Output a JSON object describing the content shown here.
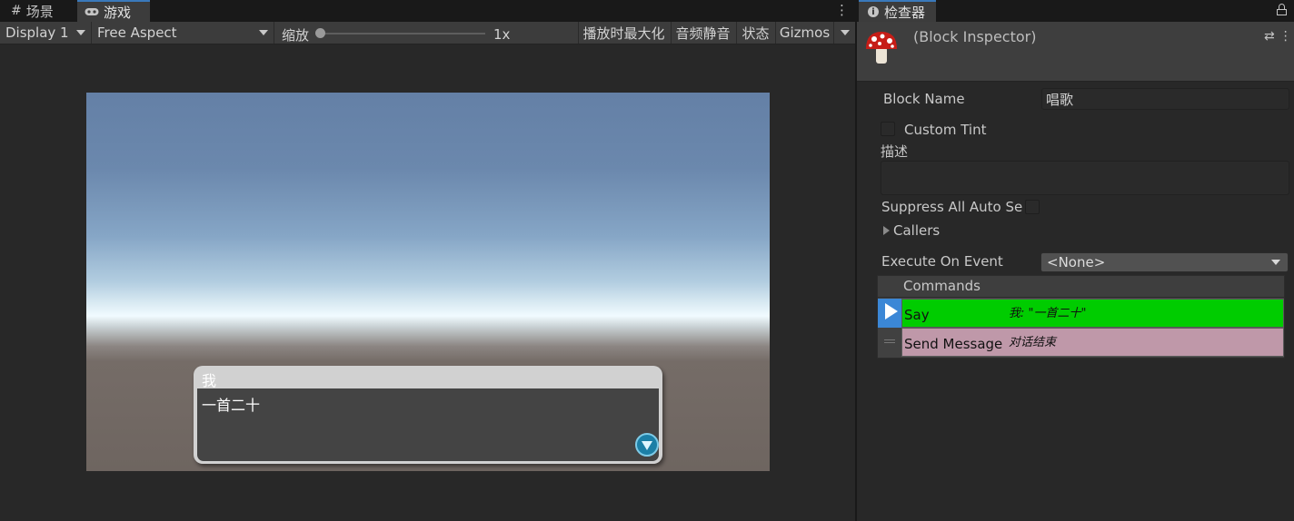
{
  "left_tabs": [
    {
      "label": "场景",
      "icon": "grid-icon"
    },
    {
      "label": "游戏",
      "icon": "gamepad-icon"
    }
  ],
  "toolbar": {
    "display": "Display 1",
    "aspect": "Free Aspect",
    "zoom_label": "缩放",
    "zoom_value": "1x",
    "maximize_label": "播放时最大化",
    "mute_label": "音频静音",
    "stats_label": "状态",
    "gizmos_label": "Gizmos"
  },
  "say_dialog": {
    "character_name": "我",
    "story_text": "一首二十"
  },
  "inspector": {
    "tab_label": "检查器",
    "title": "(Block Inspector)",
    "block_name_label": "Block Name",
    "block_name_value": "唱歌",
    "custom_tint_label": "Custom Tint",
    "description_label": "描述",
    "description_value": "",
    "suppress_label": "Suppress All Auto Se",
    "callers_label": "Callers",
    "execute_label": "Execute On Event",
    "execute_value": "<None>",
    "commands_label": "Commands",
    "commands": [
      {
        "name": "Say",
        "summary": "我: \"一首二十\"",
        "color": "#00cc00",
        "selected": true
      },
      {
        "name": "Send Message",
        "summary": "对话结束",
        "color": "#bf98a9",
        "selected": false
      }
    ]
  }
}
